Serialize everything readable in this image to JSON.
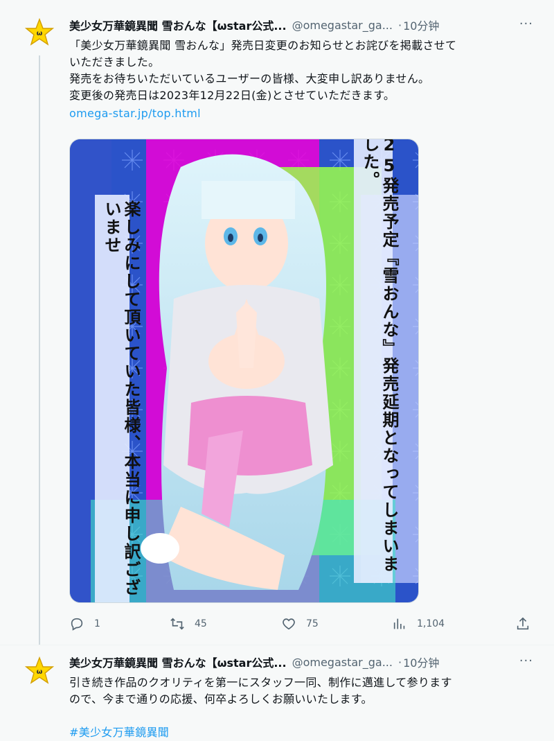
{
  "tweets": [
    {
      "name": "美少女万華鏡異聞 雪おんな【ωstar公式...",
      "handle": "@omegastar_ga...",
      "dot": "·",
      "time": "10分钟",
      "more": "···",
      "lines": [
        "「美少女万華鏡異聞 雪おんな」発売日変更のお知らせとお詫びを掲載させて",
        "いただきました。",
        "発売をお待ちいただいているユーザーの皆様、大変申し訳ありません。",
        "変更後の発売日は2023年12月22日(金)とさせていただきます。"
      ],
      "link": "omega-star.jp/top.html",
      "image": {
        "text_right": "25発売予定『雪おんな』発売延期となってしまいました。",
        "text_left": "楽しみにして頂いていた皆様、本当に申し訳ございませ"
      },
      "actions": {
        "reply": "1",
        "retweet": "45",
        "like": "75",
        "views": "1,104"
      }
    },
    {
      "name": "美少女万華鏡異聞 雪おんな【ωstar公式...",
      "handle": "@omegastar_ga...",
      "dot": "·",
      "time": "10分钟",
      "more": "···",
      "lines": [
        "引き続き作品のクオリティを第一にスタッフ一同、制作に邁進して参ります",
        "ので、今まで通りの応援、何卒よろしくお願いいたします。"
      ],
      "hashtag": "#美少女万華鏡異聞"
    }
  ],
  "colors": {
    "link": "#1d9bf0",
    "muted": "#536471",
    "avatar_star": "#ffd700"
  },
  "icons": [
    "star-logo-icon",
    "reply-icon",
    "retweet-icon",
    "like-icon",
    "views-icon",
    "share-icon"
  ]
}
